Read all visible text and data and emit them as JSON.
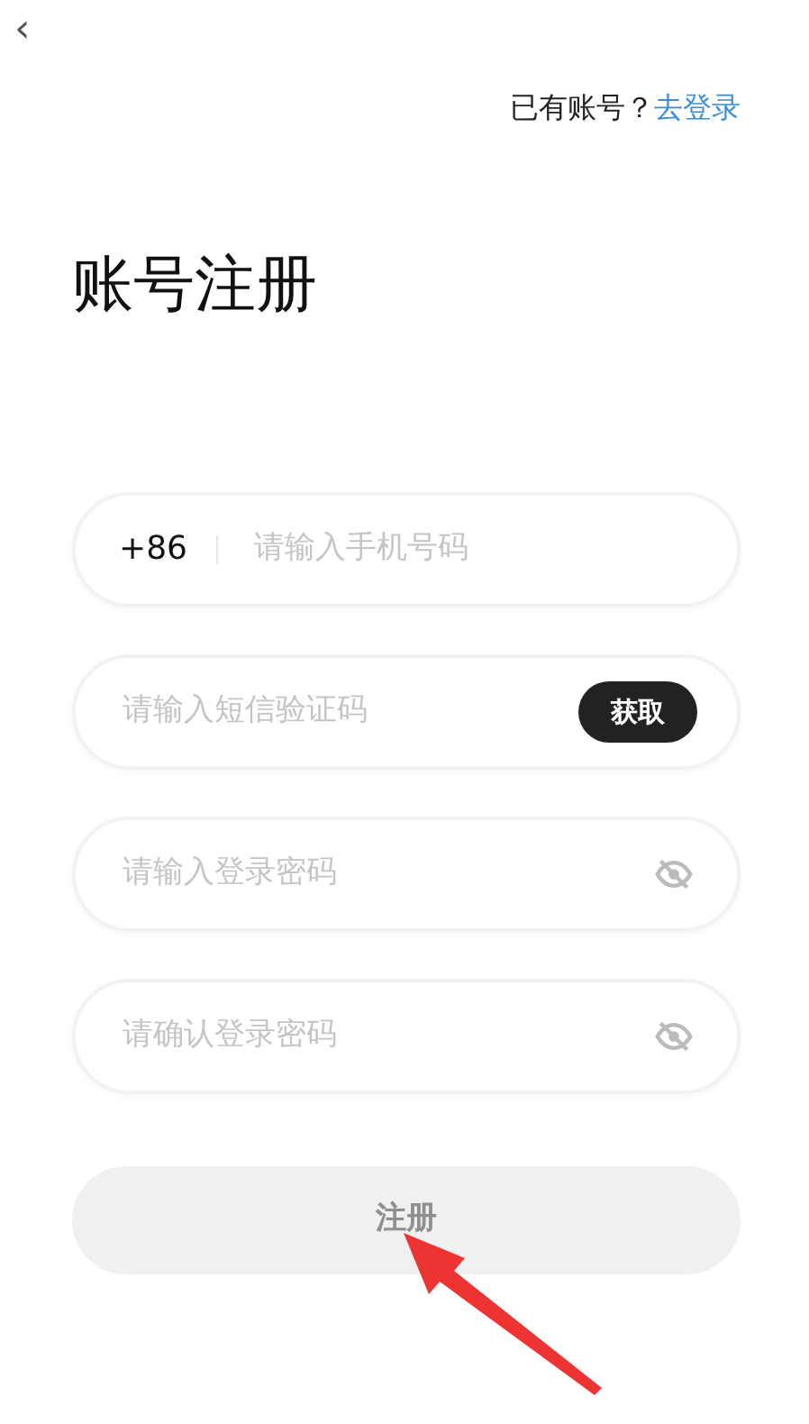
{
  "back": {
    "glyph": "‹"
  },
  "login_prompt": {
    "text": "已有账号？",
    "link": "去登录"
  },
  "title": "账号注册",
  "fields": [
    {
      "kind": "phone",
      "prefix": "+86",
      "placeholder": "请输入手机号码"
    },
    {
      "kind": "code",
      "placeholder": "请输入短信验证码",
      "button": "获取"
    },
    {
      "kind": "password",
      "placeholder": "请输入登录密码"
    },
    {
      "kind": "password",
      "placeholder": "请确认登录密码"
    }
  ],
  "submit": {
    "label": "注册",
    "disabled": true
  },
  "annotation": {
    "kind": "arrow"
  }
}
